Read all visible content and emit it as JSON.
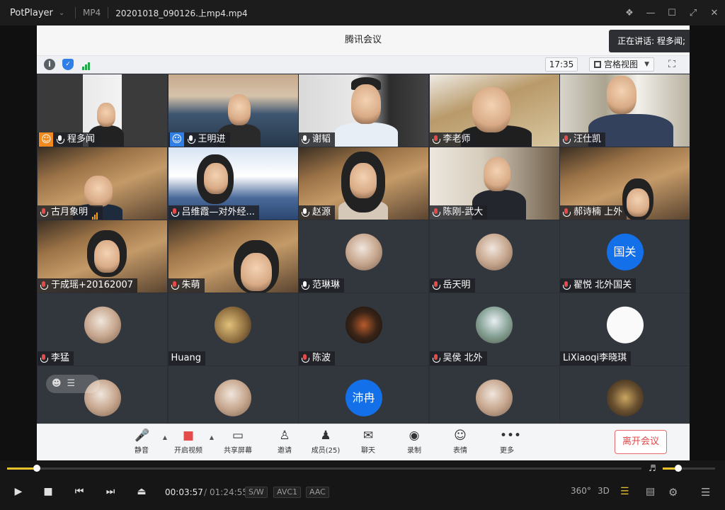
{
  "window": {
    "app_name": "PotPlayer",
    "format": "MP4",
    "file_name": "20201018_090126.上mp4.mp4"
  },
  "meeting": {
    "title": "腾讯会议",
    "speaking_label": "正在讲话: 程多闻;",
    "time": "17:35",
    "view_mode": "宫格视图"
  },
  "participants": [
    {
      "name": "程多闻",
      "mic": "on",
      "badge": "host"
    },
    {
      "name": "王明进",
      "mic": "on",
      "badge": "cohost"
    },
    {
      "name": "谢韬",
      "mic": "on"
    },
    {
      "name": "李老师",
      "mic": "muted"
    },
    {
      "name": "汪仕凯",
      "mic": "muted"
    },
    {
      "name": "古月象明",
      "mic": "muted",
      "signal": "weak"
    },
    {
      "name": "吕维霞—对外经...",
      "mic": "muted"
    },
    {
      "name": "赵源",
      "mic": "on"
    },
    {
      "name": "陈刚-武大",
      "mic": "muted"
    },
    {
      "name": "郝诗楠 上外",
      "mic": "muted"
    },
    {
      "name": "于成瑶+20162007",
      "mic": "muted"
    },
    {
      "name": "朱萌",
      "mic": "muted"
    },
    {
      "name": "范琳琳",
      "mic": "on"
    },
    {
      "name": "岳天明",
      "mic": "muted"
    },
    {
      "name": "翟悦 北外国关",
      "mic": "muted",
      "avatar_text": "国关"
    },
    {
      "name": "李猛",
      "mic": "muted"
    },
    {
      "name": "Huang",
      "mic": "none"
    },
    {
      "name": "陈波",
      "mic": "muted"
    },
    {
      "name": "吴侯 北外",
      "mic": "muted"
    },
    {
      "name": "LiXiaoqi李晓琪",
      "mic": "none"
    },
    {
      "name": "",
      "mic": "none"
    },
    {
      "name": "",
      "mic": "none"
    },
    {
      "name": "",
      "mic": "none",
      "avatar_text": "沛冉"
    },
    {
      "name": "",
      "mic": "none"
    },
    {
      "name": "",
      "mic": "none"
    }
  ],
  "toolbar": {
    "mute": "静音",
    "video": "开启视频",
    "share": "共享屏幕",
    "invite": "邀请",
    "members": "成员(25)",
    "chat": "聊天",
    "record": "录制",
    "reaction": "表情",
    "more": "更多",
    "leave": "离开会议"
  },
  "player": {
    "current_time": "00:03:57",
    "separator": "/",
    "total_time": "01:24:55",
    "tag_sw": "S/W",
    "tag_codec": "AVC1",
    "tag_audio": "AAC",
    "btn_360": "360°",
    "btn_3d": "3D",
    "progress": 0.047,
    "volume": 0.3
  },
  "colors": {
    "accent_yellow": "#e8c22e",
    "mic_green": "#1faa52",
    "leave_red": "#e04848",
    "avatar_blue": "#1470e8"
  }
}
